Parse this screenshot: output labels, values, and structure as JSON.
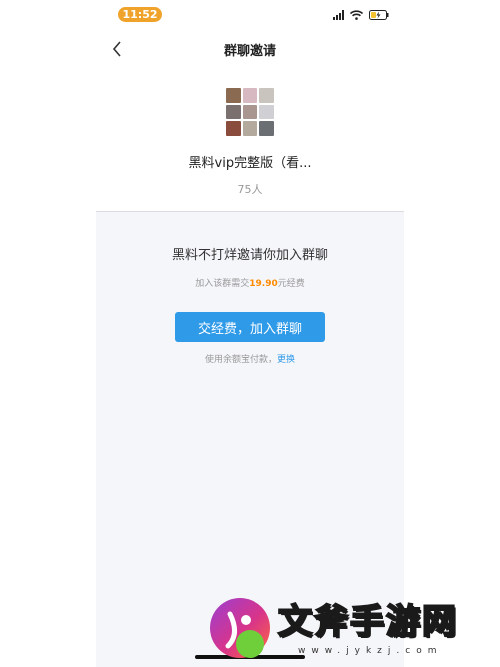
{
  "status_bar": {
    "time": "11:52"
  },
  "nav": {
    "title": "群聊邀请"
  },
  "group": {
    "name": "黑料vip完整版（看...",
    "member_count": "75人",
    "avatar_colors": [
      "#8b6a52",
      "#d7b9c2",
      "#c9c4be",
      "#7a7070",
      "#a99691",
      "#cfcfd4",
      "#8a4c3c",
      "#b3aa9d",
      "#6b6e73"
    ]
  },
  "invite": {
    "message": "黑料不打烊邀请你加入群聊",
    "fee_prefix": "加入该群需交",
    "fee_amount": "19.90",
    "fee_suffix": "元经费",
    "join_label": "交经费，加入群聊",
    "payment_text": "使用余额宝付款，",
    "change_label": "更换"
  },
  "watermark": {
    "title": "文斧手游网",
    "url": "www.jykzj.com"
  },
  "colors": {
    "accent": "#2f9ae8",
    "fee_highlight": "#ff8a00",
    "time_pill": "#f0a32b",
    "panel_bg": "#f5f6fa"
  }
}
